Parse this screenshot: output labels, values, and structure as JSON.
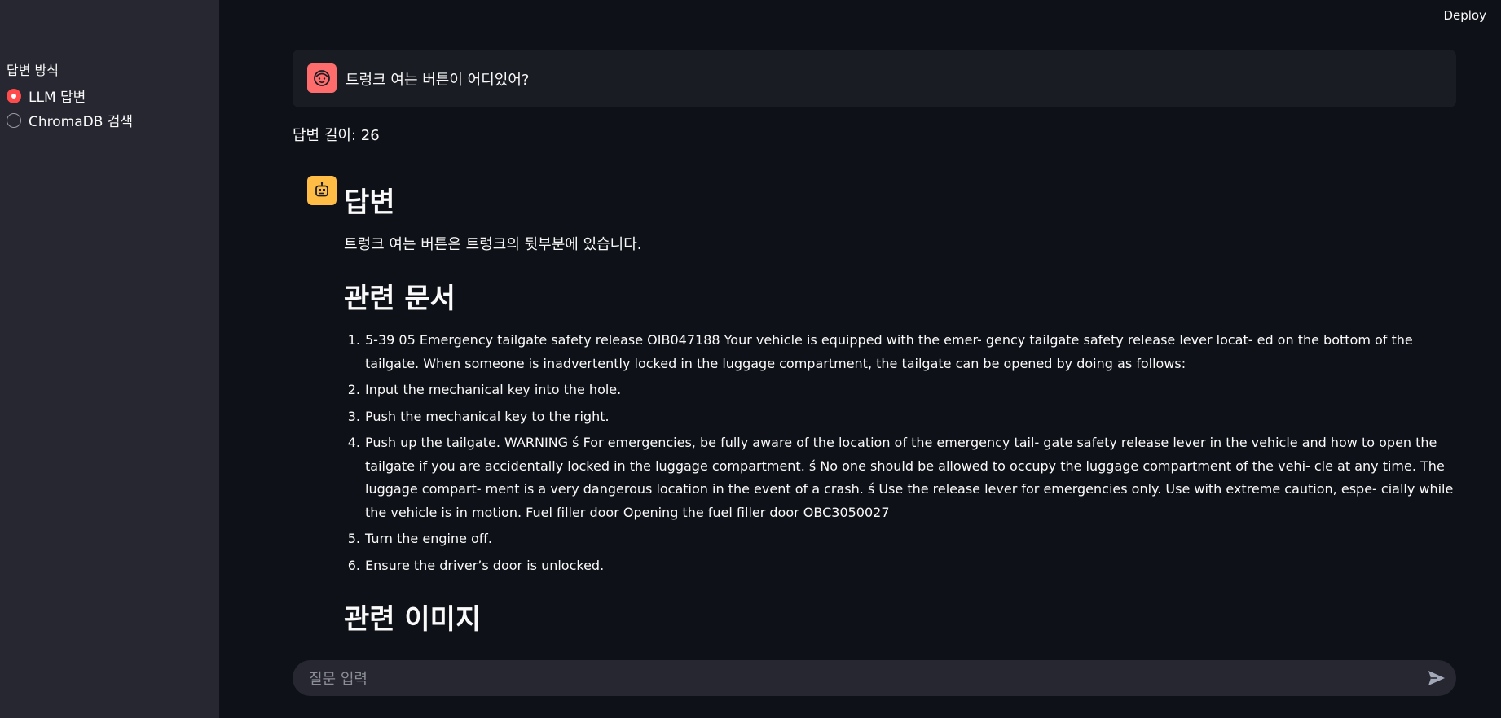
{
  "header": {
    "deploy_label": "Deploy"
  },
  "sidebar": {
    "radio_label": "답변 방식",
    "options": [
      {
        "label": "LLM 답변",
        "selected": true
      },
      {
        "label": "ChromaDB 검색",
        "selected": false
      }
    ]
  },
  "chat": {
    "user_question": "트렁크 여는 버튼이 어디있어?",
    "answer_length_text": "답변 길이: 26",
    "answer_heading": "답변",
    "answer_text": "트렁크 여는 버튼은 트렁크의 뒷부분에 있습니다.",
    "related_docs_heading": "관련 문서",
    "related_docs": [
      "5-39 05 Emergency tailgate safety release OIB047188 Your vehicle is equipped with the emer- gency tailgate safety release lever locat- ed on the bottom of the tailgate. When someone is inadvertently locked in the luggage compartment, the tailgate can be opened by doing as follows:",
      "Input the mechanical key into the hole.",
      "Push the mechanical key to the right.",
      "Push up the tailgate. WARNING ś For emergencies, be fully aware of the location of the emergency tail- gate safety release lever in the vehicle and how to open the tailgate if you are accidentally locked in the luggage compartment. ś No one should be allowed to occupy the luggage compartment of the vehi- cle at any time. The luggage compart- ment is a very dangerous location in the event of a crash. ś Use the release lever for emergencies only. Use with extreme caution, espe- cially while the vehicle is in motion. Fuel filler door Opening the fuel filler door OBC3050027",
      "Turn the engine off.",
      "Ensure the driver’s door is unlocked."
    ],
    "related_images_heading": "관련 이미지"
  },
  "input": {
    "placeholder": "질문 입력"
  },
  "colors": {
    "background": "#0e1117",
    "sidebar": "#262730",
    "accent": "#ff4b4b",
    "user_avatar": "#ff6c6c",
    "bot_avatar": "#ffbd45"
  },
  "icons": {
    "user_avatar": "smiley-face-icon",
    "bot_avatar": "robot-icon",
    "send": "send-arrow-icon"
  }
}
